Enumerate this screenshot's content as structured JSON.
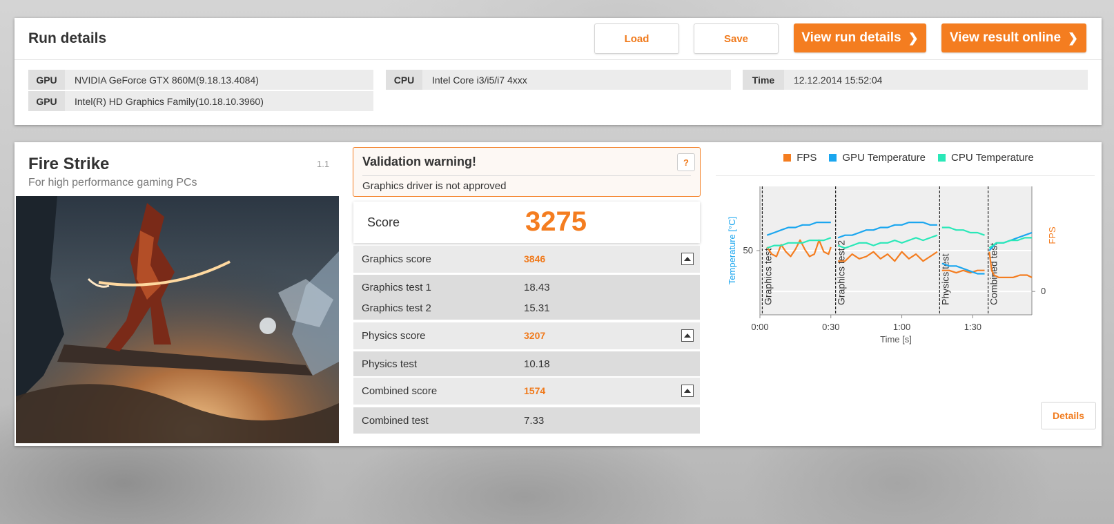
{
  "run": {
    "title": "Run details",
    "buttons": {
      "load": "Load",
      "save": "Save",
      "view_run_details": "View run details",
      "view_result_online": "View result online"
    },
    "info": {
      "gpu1": {
        "key": "GPU",
        "value": "NVIDIA GeForce GTX 860M(9.18.13.4084)"
      },
      "gpu2": {
        "key": "GPU",
        "value": "Intel(R) HD Graphics Family(10.18.10.3960)"
      },
      "cpu": {
        "key": "CPU",
        "value": "Intel Core i3/i5/i7 4xxx"
      },
      "time": {
        "key": "Time",
        "value": "12.12.2014 15:52:04"
      }
    }
  },
  "benchmark": {
    "name": "Fire Strike",
    "subtitle": "For high performance gaming PCs",
    "version": "1.1"
  },
  "validation": {
    "title": "Validation warning!",
    "help": "?",
    "message": "Graphics driver is not approved"
  },
  "score": {
    "label": "Score",
    "value": "3275"
  },
  "results": {
    "graphics": {
      "label": "Graphics score",
      "value": "3846",
      "tests": [
        {
          "label": "Graphics test 1",
          "value": "18.43"
        },
        {
          "label": "Graphics test 2",
          "value": "15.31"
        }
      ]
    },
    "physics": {
      "label": "Physics score",
      "value": "3207",
      "tests": [
        {
          "label": "Physics test",
          "value": "10.18"
        }
      ]
    },
    "combined": {
      "label": "Combined score",
      "value": "1574",
      "tests": [
        {
          "label": "Combined test",
          "value": "7.33"
        }
      ]
    }
  },
  "details_button": "Details",
  "colors": {
    "accent": "#f47d20",
    "fps": "#f47d20",
    "gpu_temp": "#1aa6ef",
    "cpu_temp": "#2ae8b8"
  },
  "chart_data": {
    "type": "line",
    "xlabel": "Time [s]",
    "ylabel_left": "Temperature [°C]",
    "ylabel_right": "FPS",
    "xlim": [
      0,
      115
    ],
    "x_ticks": [
      {
        "value": 0,
        "label": "0:00"
      },
      {
        "value": 30,
        "label": "0:30"
      },
      {
        "value": 60,
        "label": "1:00"
      },
      {
        "value": 90,
        "label": "1:30"
      }
    ],
    "ylim_left": [
      25,
      75
    ],
    "y_ticks_left": [
      50
    ],
    "ylim_right": [
      -10,
      45
    ],
    "y_ticks_right": [
      0
    ],
    "grid": true,
    "legend_position": "top-center",
    "sections": [
      {
        "x": 1,
        "label": "Graphics test"
      },
      {
        "x": 32,
        "label": "Graphics test 2"
      },
      {
        "x": 76,
        "label": "Physics test"
      },
      {
        "x": 96.5,
        "label": "Combined test"
      }
    ],
    "series": [
      {
        "name": "FPS",
        "axis": "right",
        "color": "#f47d20",
        "segments": [
          {
            "x": [
              3,
              5,
              7,
              9,
              11,
              13,
              15,
              17,
              19,
              21,
              23,
              25,
              27,
              29,
              30
            ],
            "y": [
              19,
              16,
              15,
              20,
              17,
              15,
              18,
              22,
              18,
              15,
              16,
              22,
              17,
              16,
              19
            ]
          },
          {
            "x": [
              33,
              36,
              39,
              42,
              45,
              48,
              51,
              54,
              57,
              60,
              63,
              66,
              69,
              72,
              75
            ],
            "y": [
              13,
              13,
              16,
              14,
              15,
              17,
              14,
              16,
              13,
              17,
              14,
              16,
              13,
              15,
              17
            ]
          },
          {
            "x": [
              77,
              80,
              83,
              86,
              89,
              92,
              95
            ],
            "y": [
              9,
              9,
              8,
              9,
              8,
              9,
              9
            ]
          },
          {
            "x": [
              97,
              98,
              99,
              101,
              104,
              107,
              110,
              113,
              115
            ],
            "y": [
              17,
              9,
              7,
              6,
              6,
              6,
              7,
              7,
              6
            ]
          }
        ]
      },
      {
        "name": "GPU Temperature",
        "axis": "left",
        "color": "#1aa6ef",
        "segments": [
          {
            "x": [
              3,
              6,
              9,
              12,
              15,
              18,
              21,
              24,
              27,
              30
            ],
            "y": [
              56,
              57,
              58,
              59,
              59,
              60,
              60,
              61,
              61,
              61
            ]
          },
          {
            "x": [
              33,
              36,
              39,
              42,
              45,
              48,
              51,
              54,
              57,
              60,
              63,
              66,
              69,
              72,
              75
            ],
            "y": [
              55,
              56,
              56,
              57,
              58,
              58,
              59,
              59,
              60,
              60,
              61,
              61,
              61,
              60,
              60
            ]
          },
          {
            "x": [
              77,
              80,
              83,
              86,
              89,
              92,
              95
            ],
            "y": [
              45,
              44,
              44,
              43,
              42,
              41,
              41
            ]
          },
          {
            "x": [
              97,
              100,
              103,
              106,
              109,
              112,
              115
            ],
            "y": [
              50,
              53,
              53,
              54,
              55,
              56,
              57
            ]
          }
        ]
      },
      {
        "name": "CPU Temperature",
        "axis": "left",
        "color": "#2ae8b8",
        "segments": [
          {
            "x": [
              3,
              6,
              9,
              12,
              15,
              18,
              21,
              24,
              27,
              30
            ],
            "y": [
              51,
              52,
              52,
              53,
              53,
              53,
              54,
              54,
              54,
              55
            ]
          },
          {
            "x": [
              33,
              36,
              39,
              42,
              45,
              48,
              51,
              54,
              57,
              60,
              63,
              66,
              69,
              72,
              75
            ],
            "y": [
              52,
              51,
              52,
              53,
              53,
              52,
              53,
              53,
              54,
              53,
              54,
              55,
              54,
              55,
              56
            ]
          },
          {
            "x": [
              77,
              80,
              83,
              86,
              89,
              92,
              95
            ],
            "y": [
              59,
              59,
              58,
              58,
              57,
              57,
              56
            ]
          },
          {
            "x": [
              97,
              100,
              103,
              106,
              109,
              112,
              115
            ],
            "y": [
              51,
              53,
              53,
              54,
              54,
              55,
              55
            ]
          }
        ]
      }
    ]
  }
}
